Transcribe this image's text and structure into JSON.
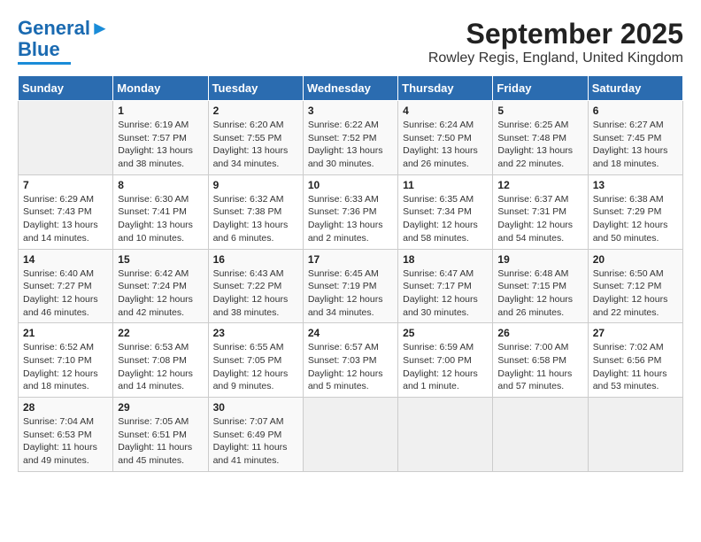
{
  "logo": {
    "line1": "General",
    "line2": "Blue"
  },
  "title": "September 2025",
  "subtitle": "Rowley Regis, England, United Kingdom",
  "days_of_week": [
    "Sunday",
    "Monday",
    "Tuesday",
    "Wednesday",
    "Thursday",
    "Friday",
    "Saturday"
  ],
  "weeks": [
    [
      {
        "day": "",
        "info": ""
      },
      {
        "day": "1",
        "info": "Sunrise: 6:19 AM\nSunset: 7:57 PM\nDaylight: 13 hours\nand 38 minutes."
      },
      {
        "day": "2",
        "info": "Sunrise: 6:20 AM\nSunset: 7:55 PM\nDaylight: 13 hours\nand 34 minutes."
      },
      {
        "day": "3",
        "info": "Sunrise: 6:22 AM\nSunset: 7:52 PM\nDaylight: 13 hours\nand 30 minutes."
      },
      {
        "day": "4",
        "info": "Sunrise: 6:24 AM\nSunset: 7:50 PM\nDaylight: 13 hours\nand 26 minutes."
      },
      {
        "day": "5",
        "info": "Sunrise: 6:25 AM\nSunset: 7:48 PM\nDaylight: 13 hours\nand 22 minutes."
      },
      {
        "day": "6",
        "info": "Sunrise: 6:27 AM\nSunset: 7:45 PM\nDaylight: 13 hours\nand 18 minutes."
      }
    ],
    [
      {
        "day": "7",
        "info": "Sunrise: 6:29 AM\nSunset: 7:43 PM\nDaylight: 13 hours\nand 14 minutes."
      },
      {
        "day": "8",
        "info": "Sunrise: 6:30 AM\nSunset: 7:41 PM\nDaylight: 13 hours\nand 10 minutes."
      },
      {
        "day": "9",
        "info": "Sunrise: 6:32 AM\nSunset: 7:38 PM\nDaylight: 13 hours\nand 6 minutes."
      },
      {
        "day": "10",
        "info": "Sunrise: 6:33 AM\nSunset: 7:36 PM\nDaylight: 13 hours\nand 2 minutes."
      },
      {
        "day": "11",
        "info": "Sunrise: 6:35 AM\nSunset: 7:34 PM\nDaylight: 12 hours\nand 58 minutes."
      },
      {
        "day": "12",
        "info": "Sunrise: 6:37 AM\nSunset: 7:31 PM\nDaylight: 12 hours\nand 54 minutes."
      },
      {
        "day": "13",
        "info": "Sunrise: 6:38 AM\nSunset: 7:29 PM\nDaylight: 12 hours\nand 50 minutes."
      }
    ],
    [
      {
        "day": "14",
        "info": "Sunrise: 6:40 AM\nSunset: 7:27 PM\nDaylight: 12 hours\nand 46 minutes."
      },
      {
        "day": "15",
        "info": "Sunrise: 6:42 AM\nSunset: 7:24 PM\nDaylight: 12 hours\nand 42 minutes."
      },
      {
        "day": "16",
        "info": "Sunrise: 6:43 AM\nSunset: 7:22 PM\nDaylight: 12 hours\nand 38 minutes."
      },
      {
        "day": "17",
        "info": "Sunrise: 6:45 AM\nSunset: 7:19 PM\nDaylight: 12 hours\nand 34 minutes."
      },
      {
        "day": "18",
        "info": "Sunrise: 6:47 AM\nSunset: 7:17 PM\nDaylight: 12 hours\nand 30 minutes."
      },
      {
        "day": "19",
        "info": "Sunrise: 6:48 AM\nSunset: 7:15 PM\nDaylight: 12 hours\nand 26 minutes."
      },
      {
        "day": "20",
        "info": "Sunrise: 6:50 AM\nSunset: 7:12 PM\nDaylight: 12 hours\nand 22 minutes."
      }
    ],
    [
      {
        "day": "21",
        "info": "Sunrise: 6:52 AM\nSunset: 7:10 PM\nDaylight: 12 hours\nand 18 minutes."
      },
      {
        "day": "22",
        "info": "Sunrise: 6:53 AM\nSunset: 7:08 PM\nDaylight: 12 hours\nand 14 minutes."
      },
      {
        "day": "23",
        "info": "Sunrise: 6:55 AM\nSunset: 7:05 PM\nDaylight: 12 hours\nand 9 minutes."
      },
      {
        "day": "24",
        "info": "Sunrise: 6:57 AM\nSunset: 7:03 PM\nDaylight: 12 hours\nand 5 minutes."
      },
      {
        "day": "25",
        "info": "Sunrise: 6:59 AM\nSunset: 7:00 PM\nDaylight: 12 hours\nand 1 minute."
      },
      {
        "day": "26",
        "info": "Sunrise: 7:00 AM\nSunset: 6:58 PM\nDaylight: 11 hours\nand 57 minutes."
      },
      {
        "day": "27",
        "info": "Sunrise: 7:02 AM\nSunset: 6:56 PM\nDaylight: 11 hours\nand 53 minutes."
      }
    ],
    [
      {
        "day": "28",
        "info": "Sunrise: 7:04 AM\nSunset: 6:53 PM\nDaylight: 11 hours\nand 49 minutes."
      },
      {
        "day": "29",
        "info": "Sunrise: 7:05 AM\nSunset: 6:51 PM\nDaylight: 11 hours\nand 45 minutes."
      },
      {
        "day": "30",
        "info": "Sunrise: 7:07 AM\nSunset: 6:49 PM\nDaylight: 11 hours\nand 41 minutes."
      },
      {
        "day": "",
        "info": ""
      },
      {
        "day": "",
        "info": ""
      },
      {
        "day": "",
        "info": ""
      },
      {
        "day": "",
        "info": ""
      }
    ]
  ]
}
